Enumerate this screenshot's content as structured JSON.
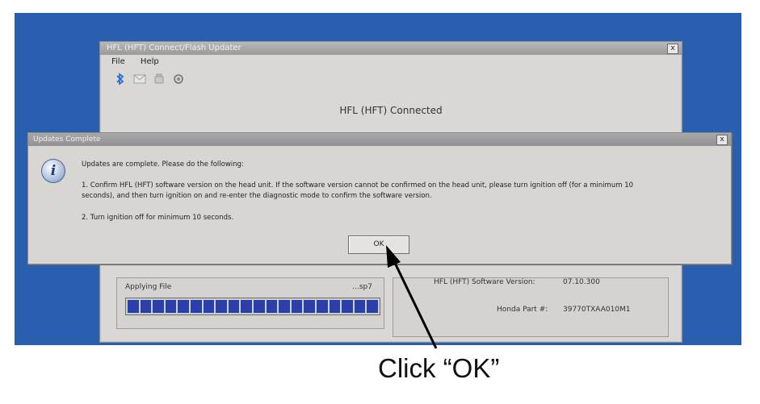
{
  "main_window": {
    "title": "HFL (HFT) Connect/Flash Updater",
    "close_glyph": "x",
    "menu": [
      "File",
      "Help"
    ],
    "toolbar_icons": [
      "bluetooth-icon",
      "mail-icon",
      "phone-icon",
      "gear-icon"
    ],
    "status_text": "HFL (HFT) Connected"
  },
  "progress_panel": {
    "label": "Applying File",
    "count": "...sp7",
    "segments": 20
  },
  "info_panel": {
    "software_version_label": "HFL (HFT) Software Version:",
    "software_version_value": "07.10.300",
    "part_label": "Honda Part #:",
    "part_value": "39770TXAA010M1"
  },
  "dialog": {
    "title": "Updates Complete",
    "close_glyph": "x",
    "icon": "info-icon",
    "intro": "Updates are complete.  Please do the following:",
    "step1_line1": "1. Confirm HFL (HFT) software version on the head unit. If the software version cannot be confirmed on the head unit, please turn ignition off (for a minimum 10",
    "step1_line2": "seconds), and then turn ignition on and re-enter the diagnostic mode to confirm the software version.",
    "step2": "2. Turn ignition off for minimum 10 seconds.",
    "ok_label": "OK"
  },
  "annotation": {
    "caption": "Click “OK”"
  },
  "colors": {
    "desktop": "#2a5fb0",
    "progress_fill": "#2a3fa8"
  }
}
